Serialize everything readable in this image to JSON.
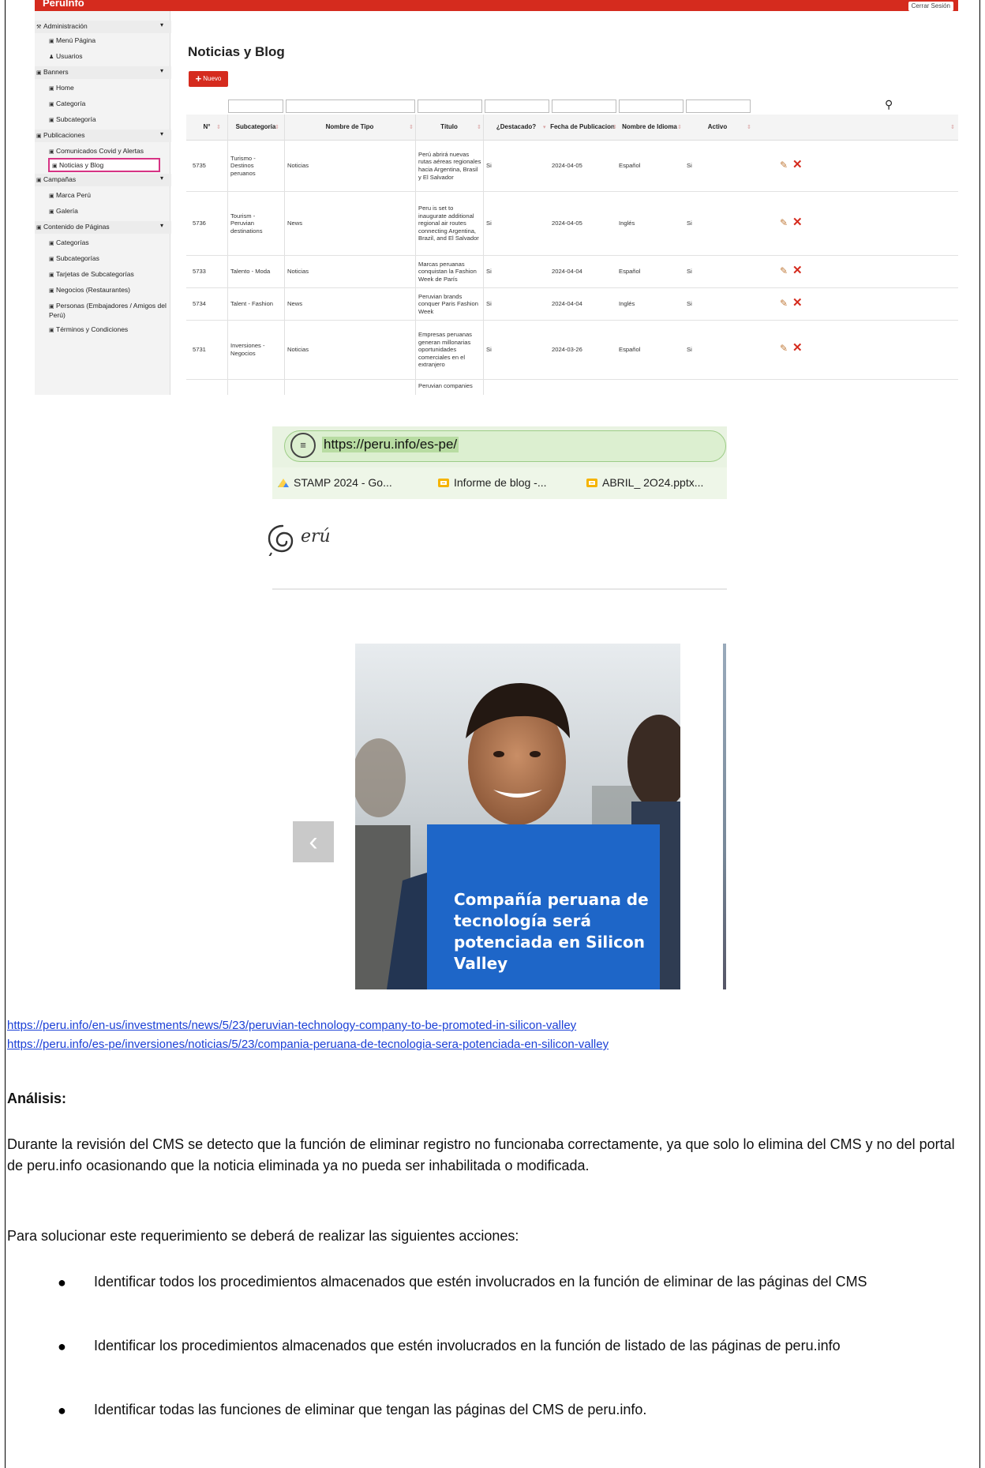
{
  "cms": {
    "brand": "PeruInfo",
    "logout": "Cerrar Sesión",
    "sidebar": [
      {
        "label": "Administración",
        "type": "group"
      },
      {
        "label": "Menú Página",
        "type": "item"
      },
      {
        "label": "Usuarios",
        "type": "item"
      },
      {
        "label": "Banners",
        "type": "group"
      },
      {
        "label": "Home",
        "type": "item"
      },
      {
        "label": "Categoría",
        "type": "item"
      },
      {
        "label": "Subcategoría",
        "type": "item"
      },
      {
        "label": "Publicaciones",
        "type": "group"
      },
      {
        "label": "Comunicados Covid y Alertas",
        "type": "item"
      },
      {
        "label": "Noticias y Blog",
        "type": "item"
      },
      {
        "label": "Campañas",
        "type": "group"
      },
      {
        "label": "Marca Perú",
        "type": "item"
      },
      {
        "label": "Galería",
        "type": "item"
      },
      {
        "label": "Contenido de Páginas",
        "type": "group"
      },
      {
        "label": "Categorías",
        "type": "item"
      },
      {
        "label": "Subcategorías",
        "type": "item"
      },
      {
        "label": "Tarjetas de Subcategorías",
        "type": "item"
      },
      {
        "label": "Negocios (Restaurantes)",
        "type": "item"
      },
      {
        "label": "Personas (Embajadores / Amigos del Perú)",
        "type": "item"
      },
      {
        "label": "Términos y Condiciones",
        "type": "item"
      }
    ],
    "page_title": "Noticias y Blog",
    "new_button": "Nuevo",
    "columns": [
      "N°",
      "Subcategoría",
      "Nombre de Tipo",
      "Título",
      "¿Destacado?",
      "Fecha de Publicacion",
      "Nombre de Idioma",
      "Activo"
    ],
    "rows": [
      {
        "id": "5735",
        "subcategoria": "Turismo - Destinos peruanos",
        "tipo": "Noticias",
        "titulo": "Perú abrirá nuevas rutas aéreas regionales hacia Argentina, Brasil y El Salvador",
        "destacado": "Si",
        "fecha": "2024-04-05",
        "idioma": "Español",
        "activo": "Si"
      },
      {
        "id": "5736",
        "subcategoria": "Tourism - Peruvian destinations",
        "tipo": "News",
        "titulo": "Peru is set to inaugurate additional regional air routes connecting Argentina, Brazil, and El Salvador",
        "destacado": "Si",
        "fecha": "2024-04-05",
        "idioma": "Inglés",
        "activo": "Si"
      },
      {
        "id": "5733",
        "subcategoria": "Talento - Moda",
        "tipo": "Noticias",
        "titulo": "Marcas peruanas conquistan la Fashion Week de París",
        "destacado": "Si",
        "fecha": "2024-04-04",
        "idioma": "Español",
        "activo": "Si"
      },
      {
        "id": "5734",
        "subcategoria": "Talent - Fashion",
        "tipo": "News",
        "titulo": "Peruvian brands conquer Paris Fashion Week",
        "destacado": "Si",
        "fecha": "2024-04-04",
        "idioma": "Inglés",
        "activo": "Si"
      },
      {
        "id": "5731",
        "subcategoria": "Inversiones - Negocios",
        "tipo": "Noticias",
        "titulo": "Empresas peruanas generan millonarias oportunidades comerciales en el extranjero",
        "destacado": "Si",
        "fecha": "2024-03-26",
        "idioma": "Español",
        "activo": "Si"
      },
      {
        "id": "",
        "subcategoria": "",
        "tipo": "",
        "titulo": "Peruvian companies",
        "destacado": "",
        "fecha": "",
        "idioma": "",
        "activo": ""
      }
    ]
  },
  "browser": {
    "url": "https://peru.info/es-pe/",
    "bookmarks": [
      "STAMP 2024 - Go...",
      "Informe de blog -...",
      "ABRIL_ 2O24.pptx..."
    ],
    "logo_text": "erú",
    "prev_arrow": "‹",
    "caption": "Compañía peruana de tecnología será potenciada en Silicon Valley"
  },
  "links": [
    "https://peru.info/en-us/investments/news/5/23/peruvian-technology-company-to-be-promoted-in-silicon-valley",
    "https://peru.info/es-pe/inversiones/noticias/5/23/compania-peruana-de-tecnologia-sera-potenciada-en-silicon-valley"
  ],
  "analysis": {
    "heading": "Análisis:",
    "paragraph1": "Durante la revisión del CMS se detecto que la función de eliminar registro no funcionaba correctamente, ya que solo lo elimina del CMS y no del portal de peru.info ocasionando que la noticia eliminada ya no pueda ser inhabilitada o modificada.",
    "paragraph2": "Para solucionar este requerimiento se deberá de realizar las siguientes acciones:",
    "bullets": [
      "Identificar todos los procedimientos almacenados que estén involucrados en la función de eliminar de las páginas del CMS",
      "Identificar los procedimientos almacenados que estén involucrados en la función de listado de las páginas de peru.info",
      "Identificar todas las funciones de eliminar que tengan las páginas del CMS de peru.info."
    ]
  },
  "colors": {
    "brand_red": "#d52b1e",
    "caption_blue": "#1e66c8",
    "link_blue": "#1a3fd6"
  }
}
